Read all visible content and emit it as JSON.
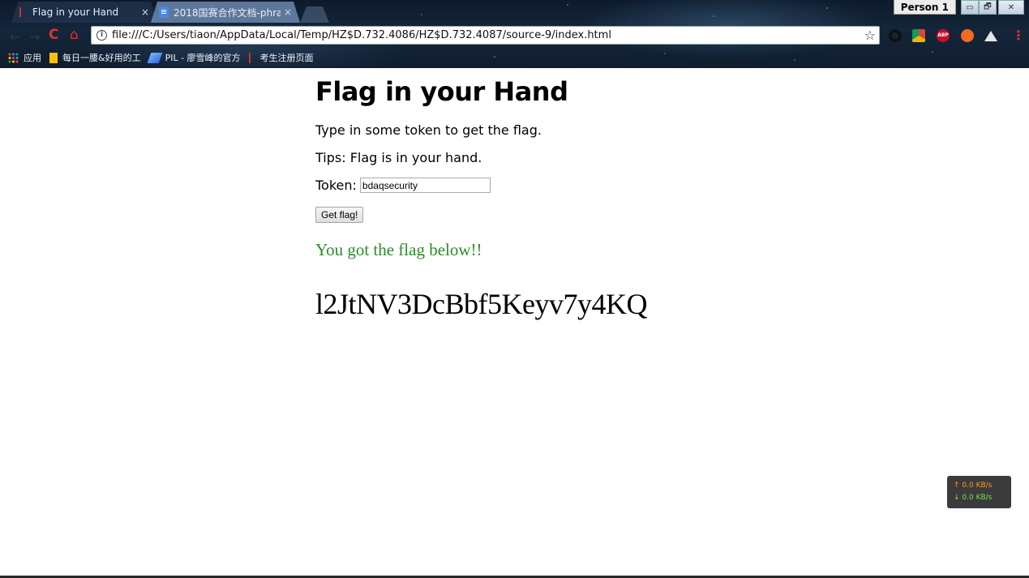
{
  "browser": {
    "tabs": [
      {
        "label": "Flag in your Hand",
        "close": "×",
        "active": false
      },
      {
        "label": "2018国赛合作文档-phra",
        "close": "×",
        "active": true
      }
    ],
    "profile_label": "Person 1",
    "window_controls": {
      "minimize": "▭",
      "maximize": "🗗",
      "close": "✕"
    },
    "address_bar": {
      "url": "file:///C:/Users/tiaon/AppData/Local/Temp/HZ$D.732.4086/HZ$D.732.4087/source-9/index.html",
      "info_glyph": "i",
      "star_glyph": "☆"
    },
    "nav": {
      "back": "←",
      "forward": "→",
      "reload": "C",
      "home": "⌂",
      "menu": "⋮"
    },
    "extensions": [
      "opera-icon",
      "chrome-icon",
      "adblock-icon",
      "orange-extension-icon",
      "drive-icon"
    ],
    "extension_labels": {
      "adblock": "ABP"
    },
    "bookmarks": [
      {
        "label": "应用",
        "icon": "apps-grid-icon"
      },
      {
        "label": "每日一腰&好用的工",
        "icon": "folder-icon"
      },
      {
        "label": "PIL - 廖雪峰的官方",
        "icon": "rocket-icon"
      },
      {
        "label": "考生注册页面",
        "icon": "page-icon"
      }
    ]
  },
  "page": {
    "title": "Flag in your Hand",
    "intro": "Type in some token to get the flag.",
    "tips": "Tips: Flag is in your hand.",
    "token_label": "Token:",
    "token_value": "bdaqsecurity",
    "button_label": "Get flag!",
    "result_message": "You got the flag below!!",
    "flag": "l2JtNV3DcBbf5Keyv7y4KQ"
  },
  "net_widget": {
    "upload": "↑ 0.0 KB/s",
    "download": "↓ 0.0 KB/s"
  },
  "colors": {
    "result_green": "#2a8a2a",
    "chrome_accent_red": "#e0332d",
    "upload_orange": "#f4a020",
    "download_green": "#7de04a"
  }
}
